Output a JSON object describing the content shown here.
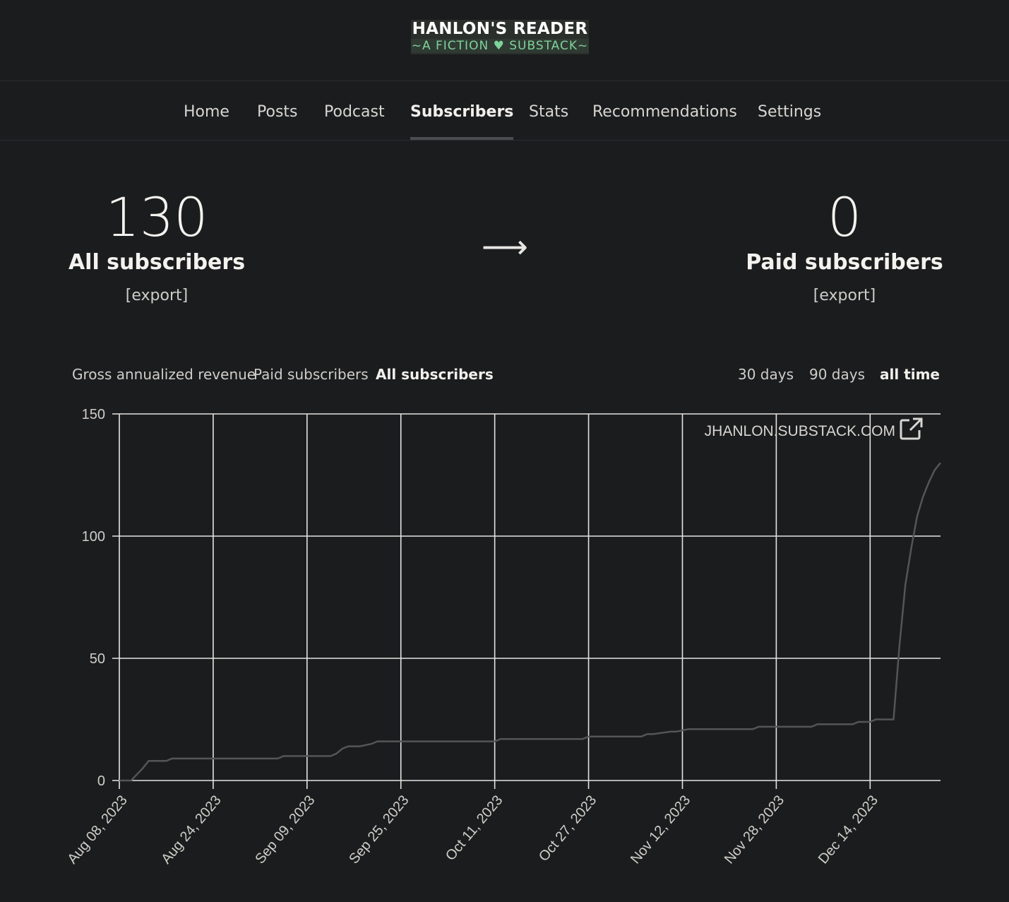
{
  "logo": {
    "line1": "HANLON'S READER",
    "line2": "~A FICTION ♥ SUBSTACK~"
  },
  "nav": {
    "items": [
      {
        "label": "Home"
      },
      {
        "label": "Posts"
      },
      {
        "label": "Podcast"
      },
      {
        "label": "Subscribers",
        "active": true
      },
      {
        "label": "Stats"
      },
      {
        "label": "Recommendations"
      },
      {
        "label": "Settings"
      }
    ]
  },
  "stats": {
    "all": {
      "value": "130",
      "label": "All subscribers",
      "export": "[export]"
    },
    "arrow": "⟶",
    "paid": {
      "value": "0",
      "label": "Paid subscribers",
      "export": "[export]"
    }
  },
  "metric_tabs": [
    {
      "label": "Gross annualized revenue"
    },
    {
      "label": "Paid subscribers"
    },
    {
      "label": "All subscribers",
      "active": true
    }
  ],
  "range_tabs": [
    {
      "label": "30 days"
    },
    {
      "label": "90 days"
    },
    {
      "label": "all time",
      "active": true
    }
  ],
  "chart_data": {
    "type": "line",
    "watermark": "JHANLON.SUBSTACK.COM",
    "ylim": [
      0,
      150
    ],
    "yticks": [
      "0",
      "50",
      "100",
      "150"
    ],
    "xtick_labels": [
      "Aug 08, 2023",
      "Aug 24, 2023",
      "Sep 09, 2023",
      "Sep 25, 2023",
      "Oct 11, 2023",
      "Oct 27, 2023",
      "Nov 12, 2023",
      "Nov 28, 2023",
      "Dec 14, 2023"
    ],
    "xtick_days": [
      0,
      16,
      32,
      48,
      64,
      80,
      96,
      112,
      128
    ],
    "xlim_days": [
      0,
      140
    ],
    "grid": true,
    "line_color": "#555555",
    "series": [
      {
        "x_days": [
          0,
          2,
          4,
          5,
          7,
          8,
          9,
          12,
          27,
          28,
          36,
          37,
          38,
          39,
          41,
          43,
          44,
          55,
          64,
          65,
          79,
          80,
          89,
          90,
          91,
          94,
          95,
          97,
          98,
          108,
          109,
          118,
          119,
          125,
          126,
          127,
          128,
          129,
          130,
          132,
          133,
          134,
          135,
          136,
          137,
          138,
          139,
          140
        ],
        "values": [
          0,
          0,
          5,
          8,
          8,
          8,
          9,
          9,
          9,
          10,
          10,
          11,
          13,
          14,
          14,
          15,
          16,
          16,
          16,
          17,
          17,
          18,
          18,
          19,
          19,
          20,
          20,
          21,
          21,
          21,
          22,
          22,
          23,
          23,
          24,
          24,
          24,
          25,
          25,
          25,
          55,
          80,
          95,
          108,
          116,
          122,
          127,
          130
        ]
      }
    ]
  }
}
